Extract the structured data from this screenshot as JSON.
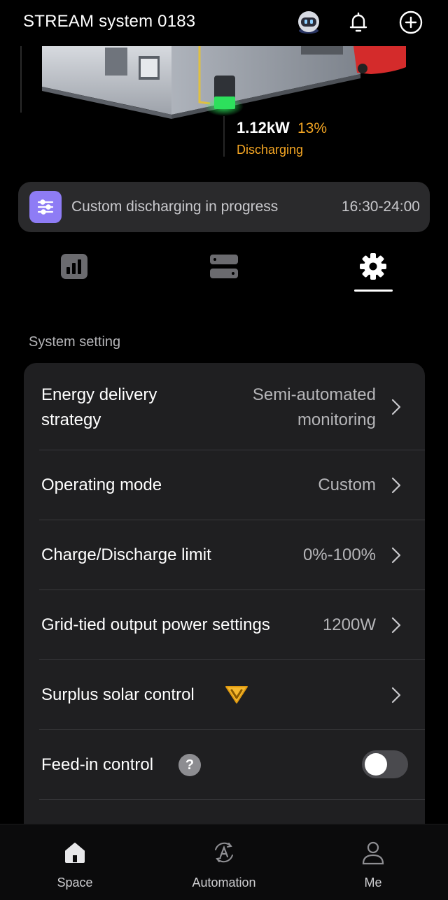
{
  "header": {
    "title": "STREAM system 0183",
    "icons": [
      "robot-avatar-icon",
      "bell-icon",
      "plus-circle-icon"
    ]
  },
  "hero": {
    "power": "1.12kW",
    "percent": "13%",
    "status": "Discharging",
    "accent_color": "#f5a623"
  },
  "banner": {
    "icon": "sliders-icon",
    "text": "Custom discharging in progress",
    "time": "16:30-24:00",
    "icon_color": "#8e7cf5"
  },
  "tabs": [
    {
      "icon": "bar-chart-icon",
      "active": false
    },
    {
      "icon": "devices-icon",
      "active": false
    },
    {
      "icon": "gear-icon",
      "active": true
    }
  ],
  "section": {
    "label": "System setting"
  },
  "settings": {
    "energy_strategy": {
      "label_line1": "Energy delivery",
      "label_line2": "strategy",
      "value_line1": "Semi-automated",
      "value_line2": "monitoring"
    },
    "operating_mode": {
      "label": "Operating mode",
      "value": "Custom"
    },
    "charge_limit": {
      "label": "Charge/Discharge limit",
      "value": "0%-100%"
    },
    "grid_output": {
      "label": "Grid-tied output power settings",
      "value": "1200W"
    },
    "surplus_solar": {
      "label": "Surplus solar control",
      "badge_icon": "premium-v-badge-icon"
    },
    "feed_in": {
      "label": "Feed-in control",
      "help": "?",
      "toggle_on": false
    }
  },
  "bottom_nav": [
    {
      "label": "Space",
      "icon": "home-icon"
    },
    {
      "label": "Automation",
      "icon": "automation-icon"
    },
    {
      "label": "Me",
      "icon": "person-icon"
    }
  ]
}
